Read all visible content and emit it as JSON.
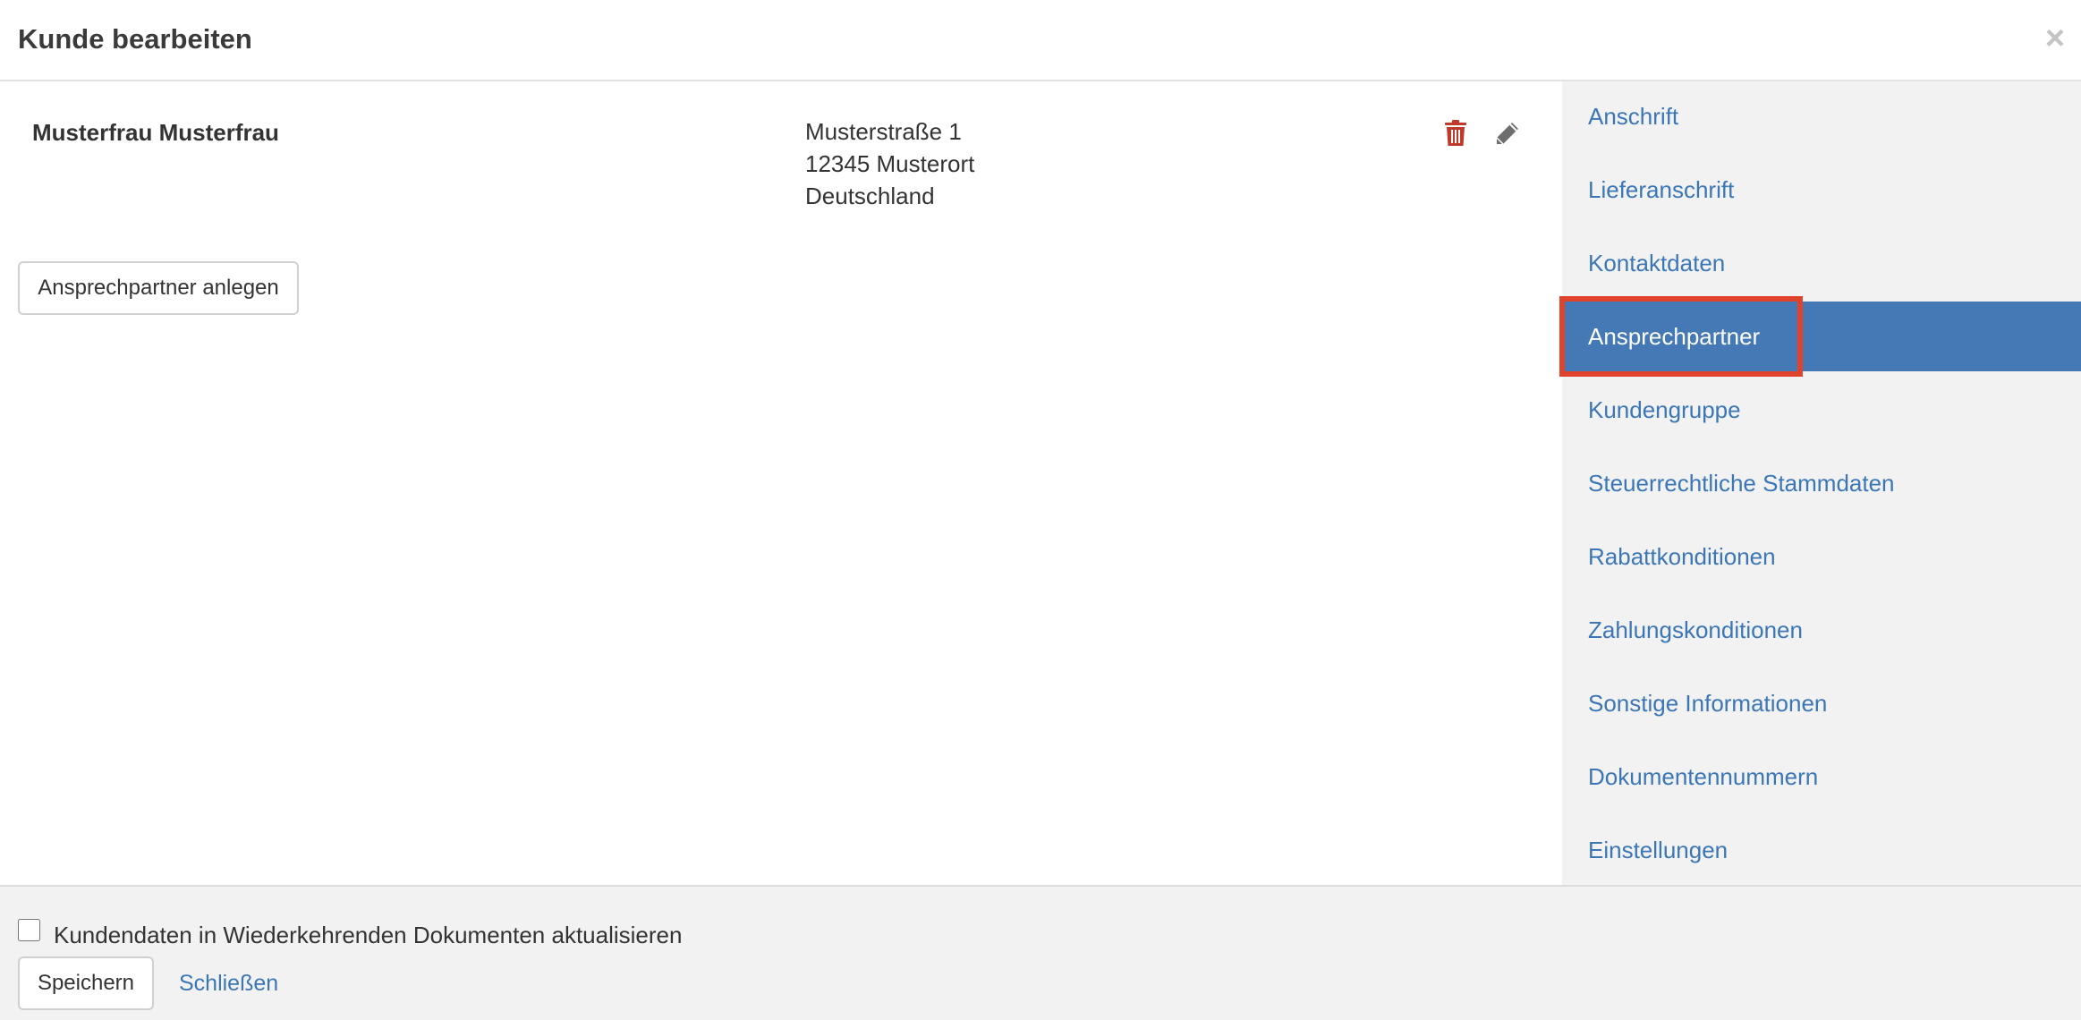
{
  "header": {
    "title": "Kunde bearbeiten",
    "close_symbol": "×"
  },
  "contact": {
    "name": "Musterfrau Musterfrau",
    "address_lines": [
      "Musterstraße 1",
      "12345 Musterort",
      "Deutschland"
    ],
    "delete_icon": "trash-icon",
    "edit_icon": "pencil-icon"
  },
  "actions": {
    "add_contact_label": "Ansprechpartner anlegen"
  },
  "sidebar": {
    "items": [
      {
        "label": "Anschrift",
        "active": false
      },
      {
        "label": "Lieferanschrift",
        "active": false
      },
      {
        "label": "Kontaktdaten",
        "active": false
      },
      {
        "label": "Ansprechpartner",
        "active": true
      },
      {
        "label": "Kundengruppe",
        "active": false
      },
      {
        "label": "Steuerrechtliche Stammdaten",
        "active": false
      },
      {
        "label": "Rabattkonditionen",
        "active": false
      },
      {
        "label": "Zahlungskonditionen",
        "active": false
      },
      {
        "label": "Sonstige Informationen",
        "active": false
      },
      {
        "label": "Dokumentennummern",
        "active": false
      },
      {
        "label": "Einstellungen",
        "active": false
      }
    ]
  },
  "footer": {
    "checkbox_label": "Kundendaten in Wiederkehrenden Dokumenten aktualisieren",
    "checkbox_checked": false,
    "save_label": "Speichern",
    "close_label": "Schließen"
  },
  "colors": {
    "link": "#3b76b6",
    "active_bg": "#4479b5",
    "highlight": "#e0432b",
    "delete": "#c0392b"
  }
}
